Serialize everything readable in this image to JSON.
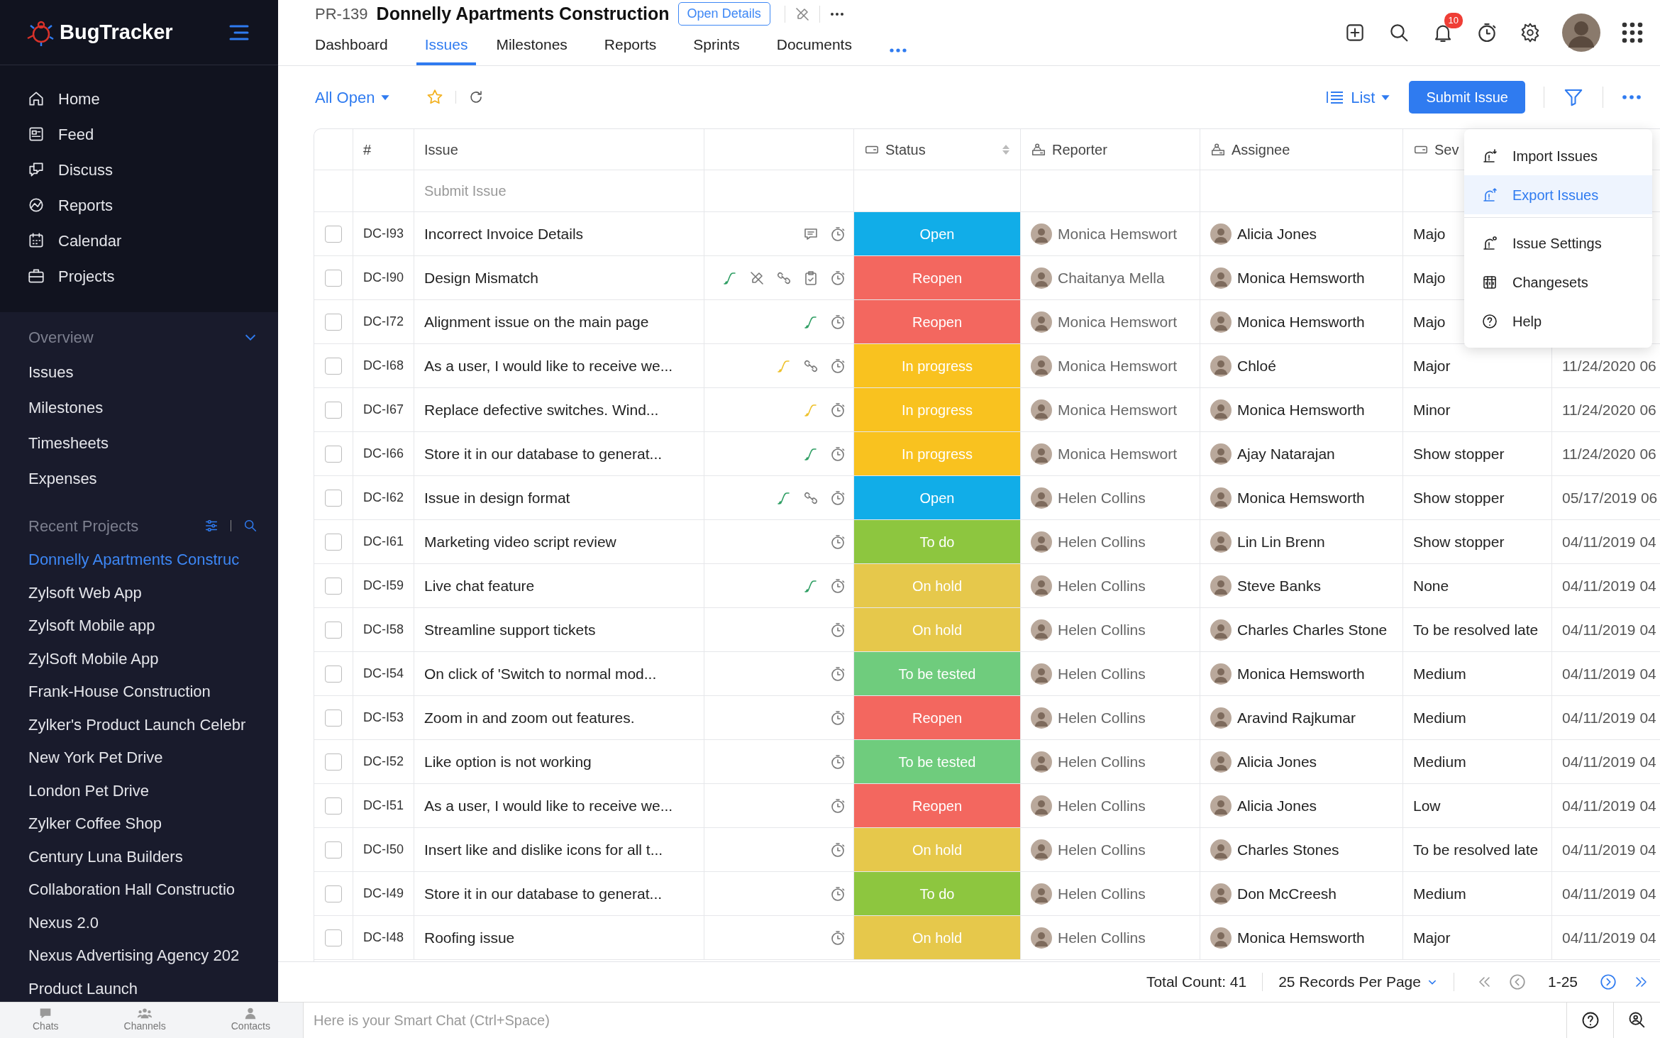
{
  "app": {
    "name": "BugTracker"
  },
  "sidebar": {
    "nav": [
      {
        "label": "Home",
        "kind": "home"
      },
      {
        "label": "Feed",
        "kind": "feed"
      },
      {
        "label": "Discuss",
        "kind": "discuss"
      },
      {
        "label": "Reports",
        "kind": "reports"
      },
      {
        "label": "Calendar",
        "kind": "calendar"
      },
      {
        "label": "Projects",
        "kind": "projects"
      }
    ],
    "overview": {
      "label": "Overview",
      "expanded": true,
      "items": [
        "Issues",
        "Milestones",
        "Timesheets",
        "Expenses"
      ]
    },
    "recent_projects": {
      "label": "Recent Projects",
      "items": [
        {
          "label": "Donnelly Apartments Construc",
          "selected": true
        },
        {
          "label": "Zylsoft Web App",
          "selected": false
        },
        {
          "label": "Zylsoft Mobile app",
          "selected": false
        },
        {
          "label": "ZylSoft Mobile App",
          "selected": false
        },
        {
          "label": "Frank-House Construction",
          "selected": false
        },
        {
          "label": "Zylker's Product Launch Celebr",
          "selected": false
        },
        {
          "label": "New York Pet Drive",
          "selected": false
        },
        {
          "label": "London Pet Drive",
          "selected": false
        },
        {
          "label": "Zylker Coffee Shop",
          "selected": false
        },
        {
          "label": "Century Luna Builders",
          "selected": false
        },
        {
          "label": "Collaboration Hall Constructio",
          "selected": false
        },
        {
          "label": "Nexus 2.0",
          "selected": false
        },
        {
          "label": "Nexus Advertising Agency 202",
          "selected": false
        },
        {
          "label": "Product Launch",
          "selected": false
        }
      ]
    }
  },
  "header": {
    "project_id": "PR-139",
    "project_name": "Donnelly Apartments Construction",
    "details_button": "Open Details",
    "notification_count": "10",
    "tabs": [
      {
        "label": "Dashboard",
        "selected": false
      },
      {
        "label": "Issues",
        "selected": true
      },
      {
        "label": "Milestones",
        "selected": false
      },
      {
        "label": "Reports",
        "selected": false
      },
      {
        "label": "Sprints",
        "selected": false
      },
      {
        "label": "Documents",
        "selected": false
      }
    ]
  },
  "toolbar": {
    "view": "All Open",
    "layout": "List",
    "submit_button": "Submit Issue"
  },
  "table": {
    "columns": [
      {
        "label": "#",
        "kind": "plain"
      },
      {
        "label": "Issue",
        "kind": "plain"
      },
      {
        "label": "Status",
        "kind": "status"
      },
      {
        "label": "Reporter",
        "kind": "person"
      },
      {
        "label": "Assignee",
        "kind": "person"
      },
      {
        "label": "Sev",
        "kind": "tag"
      }
    ],
    "new_row_placeholder": "Submit Issue",
    "rows": [
      {
        "id": "DC-I93",
        "title": "Incorrect Invoice Details",
        "checked": false,
        "icons": [
          {
            "kind": "comment"
          },
          {
            "kind": "timer"
          }
        ],
        "status": {
          "label": "Open",
          "color": "#11ade8"
        },
        "reporter": "Monica Hemswort",
        "assignee": "Alicia Jones",
        "severity": "Majo"
      },
      {
        "id": "DC-I90",
        "title": "Design Mismatch",
        "checked": false,
        "icons": [
          {
            "kind": "connector",
            "color": "#2e9e63"
          },
          {
            "kind": "pen-off"
          },
          {
            "kind": "chain"
          },
          {
            "kind": "clipboard"
          },
          {
            "kind": "timer"
          }
        ],
        "status": {
          "label": "Reopen",
          "color": "#f3675f"
        },
        "reporter": "Chaitanya Mella",
        "assignee": "Monica Hemsworth",
        "severity": "Majo"
      },
      {
        "id": "DC-I72",
        "title": "Alignment issue on the main page",
        "checked": false,
        "icons": [
          {
            "kind": "connector",
            "color": "#2e9e63"
          },
          {
            "kind": "timer"
          }
        ],
        "status": {
          "label": "Reopen",
          "color": "#f3675f"
        },
        "reporter": "Monica Hemswort",
        "assignee": "Monica Hemsworth",
        "severity": "Majo"
      },
      {
        "id": "DC-I68",
        "title": "As a user, I would like to receive we...",
        "checked": false,
        "icons": [
          {
            "kind": "connector",
            "color": "#eec12a"
          },
          {
            "kind": "chain"
          },
          {
            "kind": "timer"
          }
        ],
        "status": {
          "label": "In progress",
          "color": "#f9c21f"
        },
        "reporter": "Monica Hemswort",
        "assignee": "Chloé",
        "severity": "Major",
        "date": "11/24/2020 06"
      },
      {
        "id": "DC-I67",
        "title": "Replace defective switches. Wind...",
        "checked": false,
        "icons": [
          {
            "kind": "connector",
            "color": "#eec12a"
          },
          {
            "kind": "timer"
          }
        ],
        "status": {
          "label": "In progress",
          "color": "#f9c21f"
        },
        "reporter": "Monica Hemswort",
        "assignee": "Monica Hemsworth",
        "severity": "Minor",
        "date": "11/24/2020 06"
      },
      {
        "id": "DC-I66",
        "title": "Store it in our database to generat...",
        "checked": false,
        "icons": [
          {
            "kind": "connector",
            "color": "#2e9e63"
          },
          {
            "kind": "timer"
          }
        ],
        "status": {
          "label": "In progress",
          "color": "#f9c21f"
        },
        "reporter": "Monica Hemswort",
        "assignee": "Ajay Natarajan",
        "severity": "Show stopper",
        "date": "11/24/2020 06"
      },
      {
        "id": "DC-I62",
        "title": "Issue in design format",
        "checked": false,
        "icons": [
          {
            "kind": "connector",
            "color": "#2e9e63"
          },
          {
            "kind": "chain"
          },
          {
            "kind": "timer"
          }
        ],
        "status": {
          "label": "Open",
          "color": "#11ade8"
        },
        "reporter": "Helen Collins",
        "assignee": "Monica Hemsworth",
        "severity": "Show stopper",
        "date": "05/17/2019 06"
      },
      {
        "id": "DC-I61",
        "title": "Marketing video script review",
        "checked": false,
        "icons": [
          {
            "kind": "timer"
          }
        ],
        "status": {
          "label": "To do",
          "color": "#8dc63f"
        },
        "reporter": "Helen Collins",
        "assignee": "Lin Lin Brenn",
        "severity": "Show stopper",
        "date": "04/11/2019 04"
      },
      {
        "id": "DC-I59",
        "title": "Live chat feature",
        "checked": false,
        "icons": [
          {
            "kind": "connector",
            "color": "#2e9e63"
          },
          {
            "kind": "timer"
          }
        ],
        "status": {
          "label": "On hold",
          "color": "#e6c84b"
        },
        "reporter": "Helen Collins",
        "assignee": "Steve Banks",
        "severity": "None",
        "date": "04/11/2019 04"
      },
      {
        "id": "DC-I58",
        "title": "Streamline support tickets",
        "checked": false,
        "icons": [
          {
            "kind": "timer"
          }
        ],
        "status": {
          "label": "On hold",
          "color": "#e6c84b"
        },
        "reporter": "Helen Collins",
        "assignee": "Charles Charles Stone",
        "severity": "To be resolved late",
        "date": "04/11/2019 04"
      },
      {
        "id": "DC-I54",
        "title": "On click of 'Switch to normal mod...",
        "checked": false,
        "icons": [
          {
            "kind": "timer"
          }
        ],
        "status": {
          "label": "To be tested",
          "color": "#6fcc7d"
        },
        "reporter": "Helen Collins",
        "assignee": "Monica Hemsworth",
        "severity": "Medium",
        "date": "04/11/2019 04"
      },
      {
        "id": "DC-I53",
        "title": "Zoom in and zoom out features.",
        "checked": false,
        "icons": [
          {
            "kind": "timer"
          }
        ],
        "status": {
          "label": "Reopen",
          "color": "#f3675f"
        },
        "reporter": "Helen Collins",
        "assignee": "Aravind Rajkumar",
        "severity": "Medium",
        "date": "04/11/2019 04"
      },
      {
        "id": "DC-I52",
        "title": "Like option is not working",
        "checked": false,
        "icons": [
          {
            "kind": "timer"
          }
        ],
        "status": {
          "label": "To be tested",
          "color": "#6fcc7d"
        },
        "reporter": "Helen Collins",
        "assignee": "Alicia Jones",
        "severity": "Medium",
        "date": "04/11/2019 04"
      },
      {
        "id": "DC-I51",
        "title": "As a user, I would like to receive we...",
        "checked": false,
        "icons": [
          {
            "kind": "timer"
          }
        ],
        "status": {
          "label": "Reopen",
          "color": "#f3675f"
        },
        "reporter": "Helen Collins",
        "assignee": "Alicia Jones",
        "severity": "Low",
        "date": "04/11/2019 04"
      },
      {
        "id": "DC-I50",
        "title": "Insert like and dislike icons for all t...",
        "checked": false,
        "icons": [
          {
            "kind": "timer"
          }
        ],
        "status": {
          "label": "On hold",
          "color": "#e6c84b"
        },
        "reporter": "Helen Collins",
        "assignee": "Charles Stones",
        "severity": "To be resolved late",
        "date": "04/11/2019 04"
      },
      {
        "id": "DC-I49",
        "title": "Store it in our database to generat...",
        "checked": false,
        "icons": [
          {
            "kind": "timer"
          }
        ],
        "status": {
          "label": "To do",
          "color": "#8dc63f"
        },
        "reporter": "Helen Collins",
        "assignee": "Don McCreesh",
        "severity": "Medium",
        "date": "04/11/2019 04"
      },
      {
        "id": "DC-I48",
        "title": "Roofing issue",
        "checked": false,
        "icons": [
          {
            "kind": "timer"
          }
        ],
        "status": {
          "label": "On hold",
          "color": "#e6c84b"
        },
        "reporter": "Helen Collins",
        "assignee": "Monica Hemsworth",
        "severity": "Major",
        "date": "04/11/2019 04"
      }
    ]
  },
  "menu": {
    "items": [
      {
        "label": "Import Issues",
        "kind": "import",
        "selected": false
      },
      {
        "label": "Export Issues",
        "kind": "export",
        "selected": true
      },
      {
        "label": "Issue Settings",
        "kind": "settings",
        "selected": false
      },
      {
        "label": "Changesets",
        "kind": "changesets",
        "selected": false
      },
      {
        "label": "Help",
        "kind": "help",
        "selected": false
      }
    ]
  },
  "footer": {
    "total": "Total Count: 41",
    "per_page": "25 Records Per Page",
    "range": "1-25"
  },
  "bottom_bar": {
    "apps": [
      {
        "label": "Chats",
        "kind": "chats"
      },
      {
        "label": "Channels",
        "kind": "channels"
      },
      {
        "label": "Contacts",
        "kind": "contacts"
      }
    ],
    "chat_placeholder": "Here is your Smart Chat (Ctrl+Space)"
  }
}
